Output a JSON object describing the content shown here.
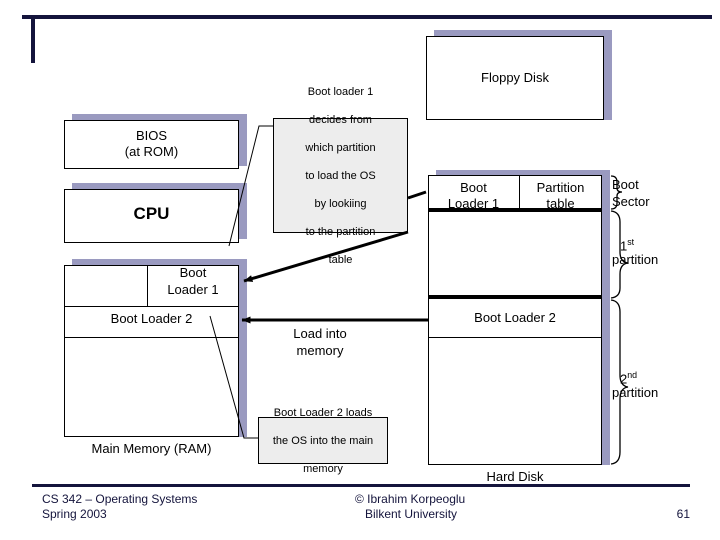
{
  "slide": {
    "page_number": "61"
  },
  "boxes": {
    "floppy_disk": {
      "label": "Floppy Disk"
    },
    "bios": {
      "line1": "BIOS",
      "line2": "(at ROM)"
    },
    "cpu": {
      "label": "CPU"
    },
    "memory": {
      "caption": "Main Memory (RAM)",
      "boot_loader_1_line1": "Boot",
      "boot_loader_1_line2": "Loader 1",
      "boot_loader_2": "Boot Loader 2"
    },
    "hard_disk": {
      "caption": "Hard Disk",
      "boot_loader_1_line1": "Boot",
      "boot_loader_1_line2": "Loader 1",
      "partition_table_line1": "Partition",
      "partition_table_line2": "table",
      "boot_loader_2": "Boot Loader 2"
    }
  },
  "braces": {
    "boot_sector_line1": "Boot",
    "boot_sector_line2": "Sector",
    "first_partition_line1": "1st",
    "first_partition_line2": "partition",
    "second_partition_line1": "2nd",
    "second_partition_line2": "partition"
  },
  "callouts": {
    "boot_loader_1_note": [
      "Boot loader 1",
      "decides from",
      "which partition",
      "to load the OS",
      "by lookiing",
      "to the partition",
      "table"
    ],
    "boot_loader_2_note": [
      "Boot Loader 2 loads",
      "the OS into the main",
      "memory"
    ]
  },
  "arrows": {
    "load_into_memory_line1": "Load into",
    "load_into_memory_line2": "memory"
  },
  "footer": {
    "course_line1": "CS 342 – Operating Systems",
    "course_line2": "Spring 2003",
    "credit_line1": "© Ibrahim Korpeoglu",
    "credit_line2": "Bilkent University",
    "page": "61"
  },
  "colors": {
    "accent_navy": "#14143c",
    "box_shadow": "#9a9ac0",
    "callout_fill": "#ededed"
  }
}
